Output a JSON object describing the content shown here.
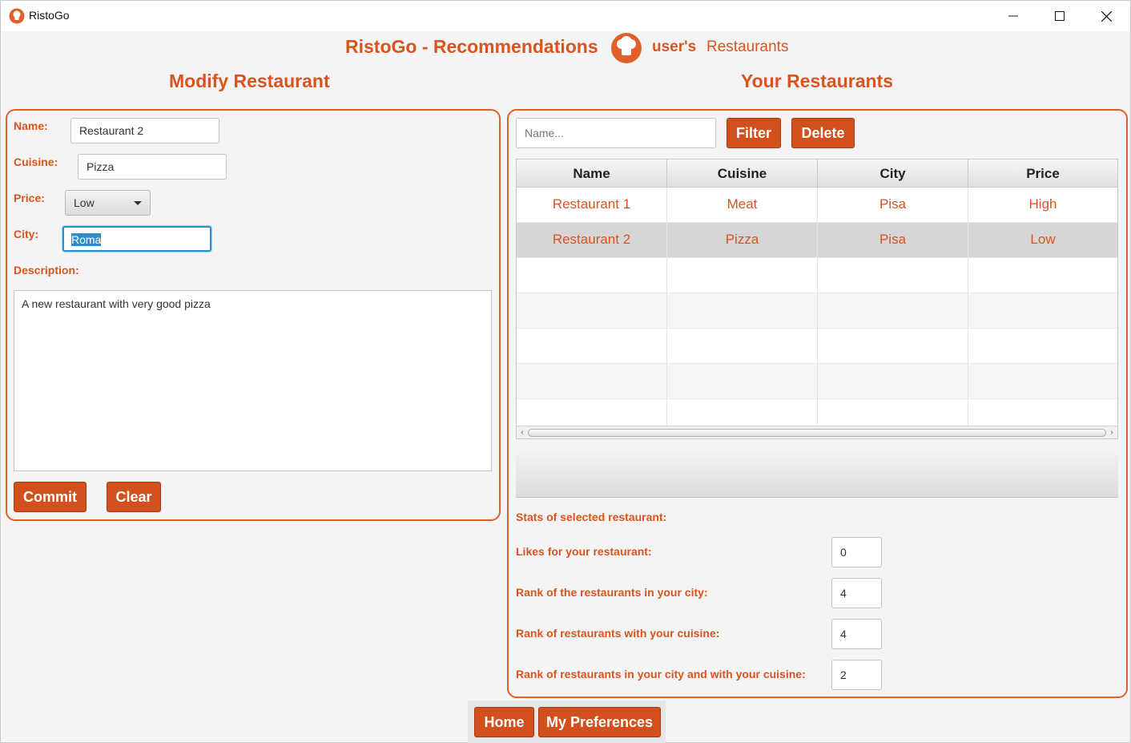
{
  "window": {
    "title": "RistoGo"
  },
  "header": {
    "title": "RistoGo - Recommendations",
    "user": "user's",
    "link": "Restaurants"
  },
  "modify": {
    "title": "Modify Restaurant",
    "name_label": "Name:",
    "name_value": "Restaurant 2",
    "cuisine_label": "Cuisine:",
    "cuisine_value": "Pizza",
    "price_label": "Price:",
    "price_value": "Low",
    "city_label": "City:",
    "city_value": "Roma",
    "description_label": "Description:",
    "description_value": "A new restaurant with very good pizza",
    "commit_label": "Commit",
    "clear_label": "Clear"
  },
  "restaurants": {
    "title": "Your Restaurants",
    "search_placeholder": "Name...",
    "filter_label": "Filter",
    "delete_label": "Delete",
    "columns": [
      "Name",
      "Cuisine",
      "City",
      "Price"
    ],
    "rows": [
      [
        "Restaurant 1",
        "Meat",
        "Pisa",
        "High"
      ],
      [
        "Restaurant 2",
        "Pizza",
        "Pisa",
        "Low"
      ]
    ],
    "selected_row": 1
  },
  "stats": {
    "title": "Stats of selected restaurant:",
    "likes_label": "Likes for your restaurant:",
    "likes_value": "0",
    "rank_city_label": "Rank of the restaurants in your city:",
    "rank_city_value": "4",
    "rank_cuisine_label": "Rank of restaurants with your cuisine:",
    "rank_cuisine_value": "4",
    "rank_both_label": "Rank of restaurants in your city and with your cuisine:",
    "rank_both_value": "2"
  },
  "nav": {
    "home_label": "Home",
    "preferences_label": "My Preferences"
  },
  "colors": {
    "accent": "#d9541e",
    "button": "#d2501d",
    "focus": "#2c8fd1"
  }
}
